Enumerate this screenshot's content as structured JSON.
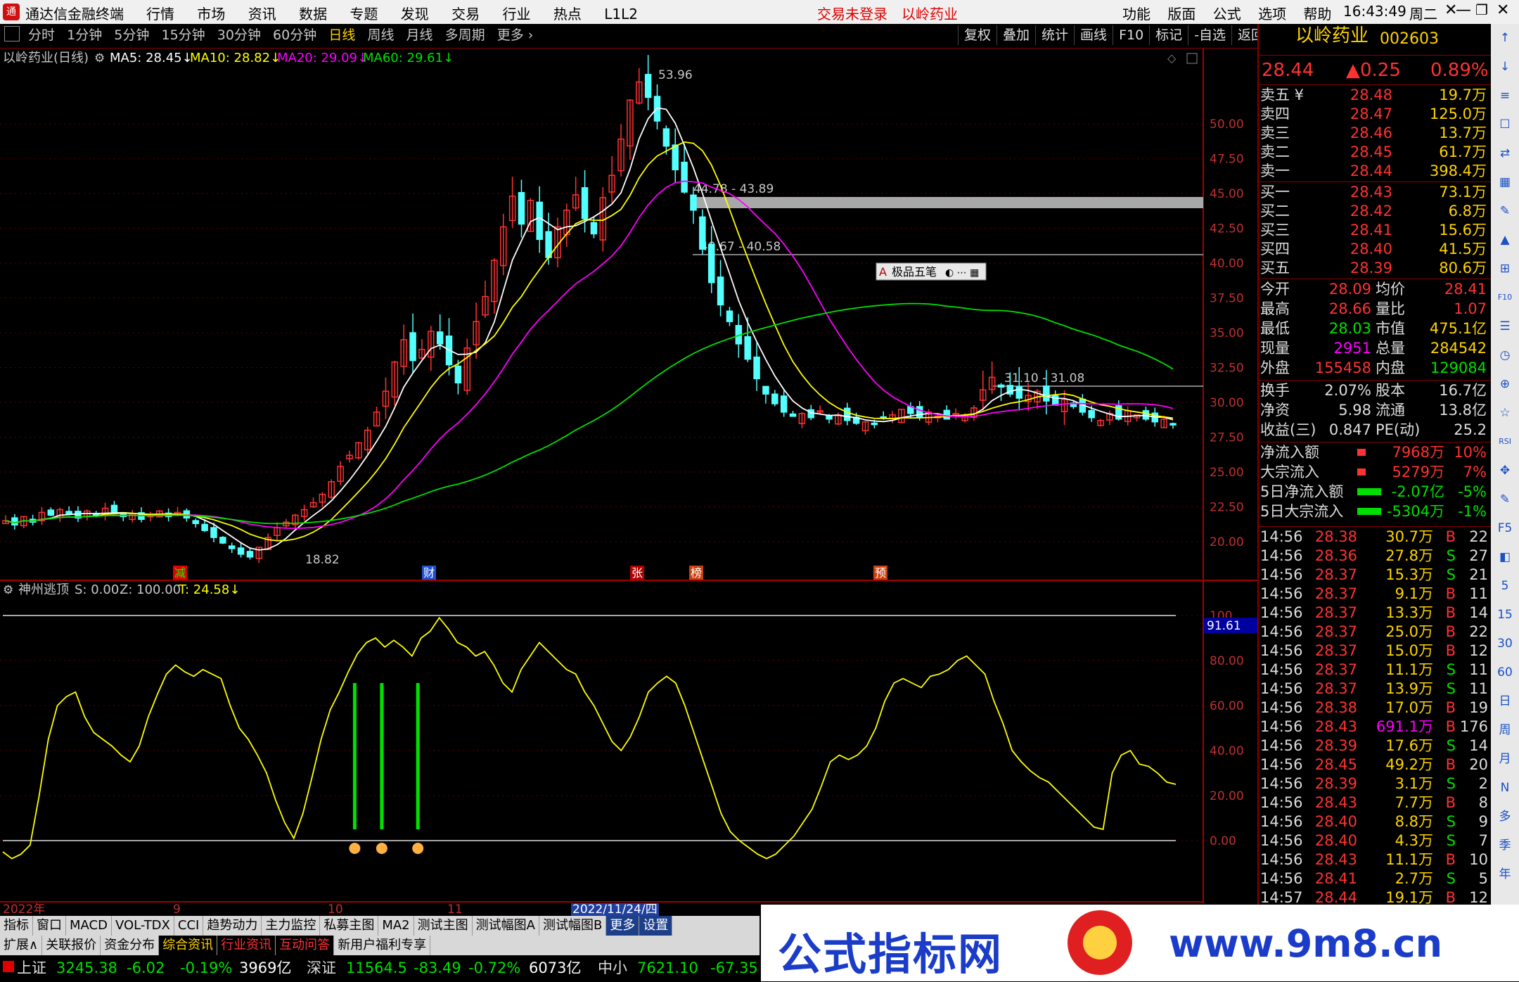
{
  "app": {
    "title": "通达信金融终端",
    "menu": [
      "行情",
      "市场",
      "资讯",
      "数据",
      "专题",
      "发现",
      "交易",
      "行业",
      "热点",
      "L1L2"
    ],
    "status_notice": "交易未登录",
    "stock_in_title": "以岭药业",
    "right_menu": [
      "功能",
      "版面",
      "公式",
      "选项",
      "帮助"
    ],
    "clock": "16:43:49",
    "weekday": "周二"
  },
  "periods": [
    "分时",
    "1分钟",
    "5分钟",
    "15分钟",
    "30分钟",
    "60分钟",
    "日线",
    "周线",
    "月线",
    "多周期",
    "更多 ›"
  ],
  "active_period": "日线",
  "right_tools": [
    "复权",
    "叠加",
    "统计",
    "画线",
    "F10",
    "标记",
    "-自选",
    "返回"
  ],
  "chart_header": {
    "stock": "以岭药业(日线)",
    "ma5": "MA5: 28.45↓",
    "ma10": "MA10: 28.82↓",
    "ma20": "MA20: 29.09↓",
    "ma60": "MA60: 29.61↓"
  },
  "colors": {
    "up": "#ff3232",
    "down": "#54ffff",
    "ma5": "#ffffff",
    "ma10": "#ffff00",
    "ma20": "#ff00ff",
    "ma60": "#00e000",
    "indicator": "#ffff00"
  },
  "chart_data": {
    "type": "candlestick",
    "y_ticks": [
      "50.00",
      "47.50",
      "45.00",
      "42.50",
      "40.00",
      "37.50",
      "35.00",
      "32.50",
      "30.00",
      "27.50",
      "25.00",
      "22.50",
      "20.00"
    ],
    "annotations": {
      "high": "53.96",
      "low": "18.82",
      "zone1": "44.78 - 43.89",
      "zone2": "40.67 - 40.58",
      "zone3": "31.10 - 31.08"
    },
    "event_markers": [
      "减",
      "财",
      "张",
      "榜",
      "预"
    ],
    "toolbar_popup": "极品五笔",
    "closes": [
      21.5,
      21.2,
      21.8,
      21.4,
      22.1,
      21.9,
      22.3,
      22.0,
      21.7,
      22.2,
      21.9,
      22.4,
      22.1,
      21.8,
      22.0,
      21.6,
      21.9,
      22.2,
      21.8,
      22.1,
      21.7,
      21.3,
      20.8,
      20.3,
      19.9,
      19.5,
      19.1,
      18.9,
      19.6,
      20.3,
      21.0,
      21.4,
      21.9,
      22.3,
      22.8,
      23.4,
      24.3,
      25.4,
      26.2,
      27.1,
      28.0,
      29.3,
      30.8,
      32.9,
      34.5,
      33.0,
      33.8,
      35.1,
      34.2,
      32.7,
      31.4,
      33.9,
      35.8,
      37.6,
      40.2,
      42.6,
      44.8,
      42.8,
      44.5,
      41.7,
      40.4,
      42.6,
      43.8,
      44.9,
      43.2,
      42.1,
      44.7,
      46.3,
      48.9,
      51.7,
      53.0,
      51.9,
      50.2,
      48.4,
      46.7,
      45.1,
      43.8,
      41.0,
      38.6,
      37.0,
      35.8,
      34.2,
      33.1,
      31.7,
      30.6,
      29.9,
      29.3,
      29.0,
      29.2,
      28.9,
      29.4,
      28.8,
      29.1,
      28.7,
      28.5,
      28.6,
      28.4,
      28.9,
      29.1,
      29.5,
      29.2,
      28.9,
      29.3,
      29.0,
      28.8,
      29.2,
      29.1,
      29.6,
      30.9,
      31.8,
      31.1,
      30.6,
      30.3,
      30.5,
      30.8,
      30.1,
      29.8,
      30.2,
      29.7,
      29.3,
      28.9,
      28.7,
      29.2,
      28.8,
      29.4,
      29.1,
      28.8,
      28.6,
      28.8,
      28.44
    ],
    "indicator": {
      "name": "神州逃顶",
      "s": "S: 0.00",
      "z": "Z: 100.00",
      "t": "T: 24.58↓",
      "current": "91.61",
      "y_ticks": [
        "100",
        "80.00",
        "60.00",
        "40.00",
        "20.00",
        "0.00"
      ],
      "values": [
        -5,
        -8,
        -6,
        -2,
        20,
        45,
        60,
        64,
        66,
        55,
        48,
        45,
        42,
        38,
        35,
        42,
        55,
        65,
        74,
        78,
        75,
        73,
        76,
        74,
        72,
        60,
        50,
        45,
        38,
        30,
        18,
        8,
        1,
        12,
        28,
        45,
        58,
        66,
        75,
        83,
        88,
        90,
        86,
        89,
        86,
        82,
        90,
        93,
        99,
        94,
        88,
        86,
        82,
        84,
        78,
        70,
        66,
        76,
        82,
        88,
        84,
        80,
        76,
        74,
        66,
        60,
        52,
        44,
        40,
        46,
        55,
        66,
        70,
        73,
        70,
        60,
        48,
        36,
        24,
        12,
        4,
        0,
        -3,
        -6,
        -8,
        -6,
        -2,
        2,
        8,
        14,
        24,
        35,
        38,
        36,
        38,
        42,
        50,
        62,
        70,
        72,
        70,
        68,
        73,
        74,
        76,
        80,
        82,
        78,
        74,
        62,
        52,
        40,
        35,
        31,
        28,
        26,
        22,
        18,
        14,
        10,
        6,
        5,
        30,
        38,
        40,
        34,
        33,
        30,
        26,
        25
      ],
      "signals": [
        0,
        0,
        0,
        0,
        0,
        0,
        0,
        0,
        0,
        0,
        0,
        0,
        0,
        0,
        0,
        0,
        0,
        0,
        0,
        0,
        0,
        0,
        0,
        0,
        0,
        0,
        0,
        0,
        0,
        0,
        0,
        0,
        0,
        0,
        0,
        0,
        0,
        0,
        0,
        1,
        0,
        0,
        1,
        0,
        0,
        0,
        1
      ]
    },
    "time_labels": [
      "2022年",
      "9",
      "10",
      "11",
      "2022/11/24/四"
    ]
  },
  "quote": {
    "name": "以岭药业",
    "code": "002603",
    "price": "28.44",
    "change": "▲0.25",
    "pct": "0.89%",
    "asks": [
      {
        "label": "卖五 ¥",
        "price": "28.48",
        "vol": "19.7万"
      },
      {
        "label": "卖四",
        "price": "28.47",
        "vol": "125.0万"
      },
      {
        "label": "卖三",
        "price": "28.46",
        "vol": "13.7万"
      },
      {
        "label": "卖二",
        "price": "28.45",
        "vol": "61.7万"
      },
      {
        "label": "卖一",
        "price": "28.44",
        "vol": "398.4万"
      }
    ],
    "bids": [
      {
        "label": "买一",
        "price": "28.43",
        "vol": "73.1万"
      },
      {
        "label": "买二",
        "price": "28.42",
        "vol": "6.8万"
      },
      {
        "label": "买三",
        "price": "28.41",
        "vol": "15.6万"
      },
      {
        "label": "买四",
        "price": "28.40",
        "vol": "41.5万"
      },
      {
        "label": "买五",
        "price": "28.39",
        "vol": "80.6万"
      }
    ],
    "stats1": [
      {
        "k1": "今开",
        "v1": "28.09",
        "k2": "均价",
        "v2": "28.41"
      },
      {
        "k1": "最高",
        "v1": "28.66",
        "k2": "量比",
        "v2": "1.07"
      },
      {
        "k1": "最低",
        "v1": "28.03",
        "k2": "市值",
        "v2": "475.1亿"
      },
      {
        "k1": "现量",
        "v1": "2951",
        "k2": "总量",
        "v2": "284542"
      },
      {
        "k1": "外盘",
        "v1": "155458",
        "k2": "内盘",
        "v2": "129084"
      }
    ],
    "stats2": [
      {
        "k1": "换手",
        "v1": "2.07%",
        "k2": "股本",
        "v2": "16.7亿"
      },
      {
        "k1": "净资",
        "v1": "5.98",
        "k2": "流通",
        "v2": "13.8亿"
      },
      {
        "k1": "收益(三)",
        "v1": "0.847",
        "k2": "PE(动)",
        "v2": "25.2"
      }
    ],
    "flows": [
      {
        "k": "净流入额",
        "v": "7968万",
        "p": "10%"
      },
      {
        "k": "大宗流入",
        "v": "5279万",
        "p": "7%"
      },
      {
        "k": "5日净流入额",
        "v": "-2.07亿",
        "p": "-5%"
      },
      {
        "k": "5日大宗流入",
        "v": "-5304万",
        "p": "-1%"
      }
    ],
    "ticks": [
      {
        "t": "14:56",
        "p": "28.38",
        "v": "30.7万",
        "d": "B",
        "n": "22"
      },
      {
        "t": "14:56",
        "p": "28.36",
        "v": "27.8万",
        "d": "S",
        "n": "27"
      },
      {
        "t": "14:56",
        "p": "28.37",
        "v": "15.3万",
        "d": "S",
        "n": "21"
      },
      {
        "t": "14:56",
        "p": "28.37",
        "v": "9.1万",
        "d": "B",
        "n": "11"
      },
      {
        "t": "14:56",
        "p": "28.37",
        "v": "13.3万",
        "d": "B",
        "n": "14"
      },
      {
        "t": "14:56",
        "p": "28.37",
        "v": "25.0万",
        "d": "B",
        "n": "22"
      },
      {
        "t": "14:56",
        "p": "28.37",
        "v": "15.0万",
        "d": "B",
        "n": "12"
      },
      {
        "t": "14:56",
        "p": "28.37",
        "v": "11.1万",
        "d": "S",
        "n": "11"
      },
      {
        "t": "14:56",
        "p": "28.37",
        "v": "13.9万",
        "d": "S",
        "n": "11"
      },
      {
        "t": "14:56",
        "p": "28.38",
        "v": "17.0万",
        "d": "B",
        "n": "19"
      },
      {
        "t": "14:56",
        "p": "28.43",
        "v": "691.1万",
        "d": "B",
        "n": "176"
      },
      {
        "t": "14:56",
        "p": "28.39",
        "v": "17.6万",
        "d": "S",
        "n": "14"
      },
      {
        "t": "14:56",
        "p": "28.45",
        "v": "49.2万",
        "d": "B",
        "n": "20"
      },
      {
        "t": "14:56",
        "p": "28.39",
        "v": "3.1万",
        "d": "S",
        "n": "2"
      },
      {
        "t": "14:56",
        "p": "28.43",
        "v": "7.7万",
        "d": "B",
        "n": "8"
      },
      {
        "t": "14:56",
        "p": "28.40",
        "v": "8.8万",
        "d": "S",
        "n": "9"
      },
      {
        "t": "14:56",
        "p": "28.40",
        "v": "4.3万",
        "d": "S",
        "n": "7"
      },
      {
        "t": "14:56",
        "p": "28.43",
        "v": "11.1万",
        "d": "B",
        "n": "10"
      },
      {
        "t": "14:56",
        "p": "28.41",
        "v": "2.7万",
        "d": "S",
        "n": "5"
      },
      {
        "t": "14:57",
        "p": "28.44",
        "v": "19.1万",
        "d": "B",
        "n": "12"
      }
    ]
  },
  "side_icons": [
    "↑",
    "↓",
    "≡",
    "☐",
    "⇄",
    "▦",
    "✎",
    "▲",
    "⊞",
    "F10",
    "☰",
    "◷",
    "⊕",
    "☆",
    "RSI",
    "✥",
    "✎",
    "F5",
    "◧",
    "5",
    "15",
    "30",
    "60",
    "日",
    "周",
    "月",
    "N",
    "多",
    "季",
    "年"
  ],
  "bottom_tabs1": [
    "指标",
    "窗口",
    "MACD",
    "VOL-TDX",
    "CCI",
    "趋势动力",
    "主力监控",
    "私募主图",
    "MA2",
    "测试主图",
    "测试幅图A",
    "测试幅图B",
    "更多",
    "设置"
  ],
  "bottom_tabs2": [
    "扩展∧",
    "关联报价",
    "资金分布",
    "综合资讯",
    "行业资讯",
    "互动问答",
    "新用户福利专享"
  ],
  "statusbar": [
    {
      "name": "上证",
      "val": "3245.38",
      "chg": "-6.02",
      "pct": "-0.19%",
      "amt": "3969亿"
    },
    {
      "name": "深证",
      "val": "11564.5",
      "chg": "-83.49",
      "pct": "-0.72%",
      "amt": "6073亿"
    },
    {
      "name": "中小",
      "val": "7621.10",
      "chg": "-67.35",
      "pct": "",
      "amt": ""
    }
  ],
  "banner": {
    "text": "公式指标网",
    "url": "www.9m8.cn"
  }
}
